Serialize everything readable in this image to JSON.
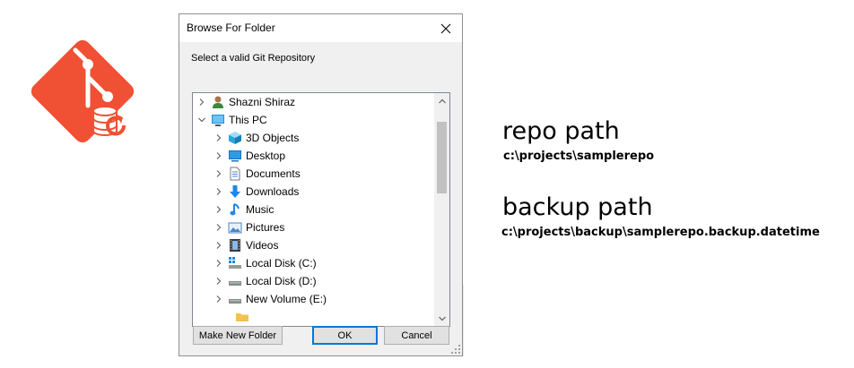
{
  "dialog": {
    "title": "Browse For Folder",
    "prompt": "Select a valid Git Repository",
    "tree": [
      {
        "label": "Shazni Shiraz",
        "icon": "user-icon",
        "expander": "right"
      },
      {
        "label": "This PC",
        "icon": "this-pc-icon",
        "expander": "down"
      },
      {
        "label": "3D Objects",
        "icon": "3d-objects-icon",
        "expander": "right"
      },
      {
        "label": "Desktop",
        "icon": "desktop-icon",
        "expander": "right"
      },
      {
        "label": "Documents",
        "icon": "documents-icon",
        "expander": "right"
      },
      {
        "label": "Downloads",
        "icon": "downloads-icon",
        "expander": "right"
      },
      {
        "label": "Music",
        "icon": "music-icon",
        "expander": "right"
      },
      {
        "label": "Pictures",
        "icon": "pictures-icon",
        "expander": "right"
      },
      {
        "label": "Videos",
        "icon": "videos-icon",
        "expander": "right"
      },
      {
        "label": "Local Disk (C:)",
        "icon": "local-disk-c-icon",
        "expander": "right"
      },
      {
        "label": "Local Disk (D:)",
        "icon": "local-disk-d-icon",
        "expander": "right"
      },
      {
        "label": "New Volume (E:)",
        "icon": "new-volume-e-icon",
        "expander": "right"
      }
    ],
    "buttons": {
      "make_new_folder": "Make New Folder",
      "ok": "OK",
      "cancel": "Cancel"
    }
  },
  "annotations": {
    "repo_title": "repo path",
    "repo_path": "c:\\projects\\samplerepo",
    "backup_title": "backup path",
    "backup_path": "c:\\projects\\backup\\samplerepo.backup.datetime"
  },
  "colors": {
    "git_logo": "#f05033",
    "dialog_bg": "#f0f0f0",
    "accent": "#0078d7"
  }
}
